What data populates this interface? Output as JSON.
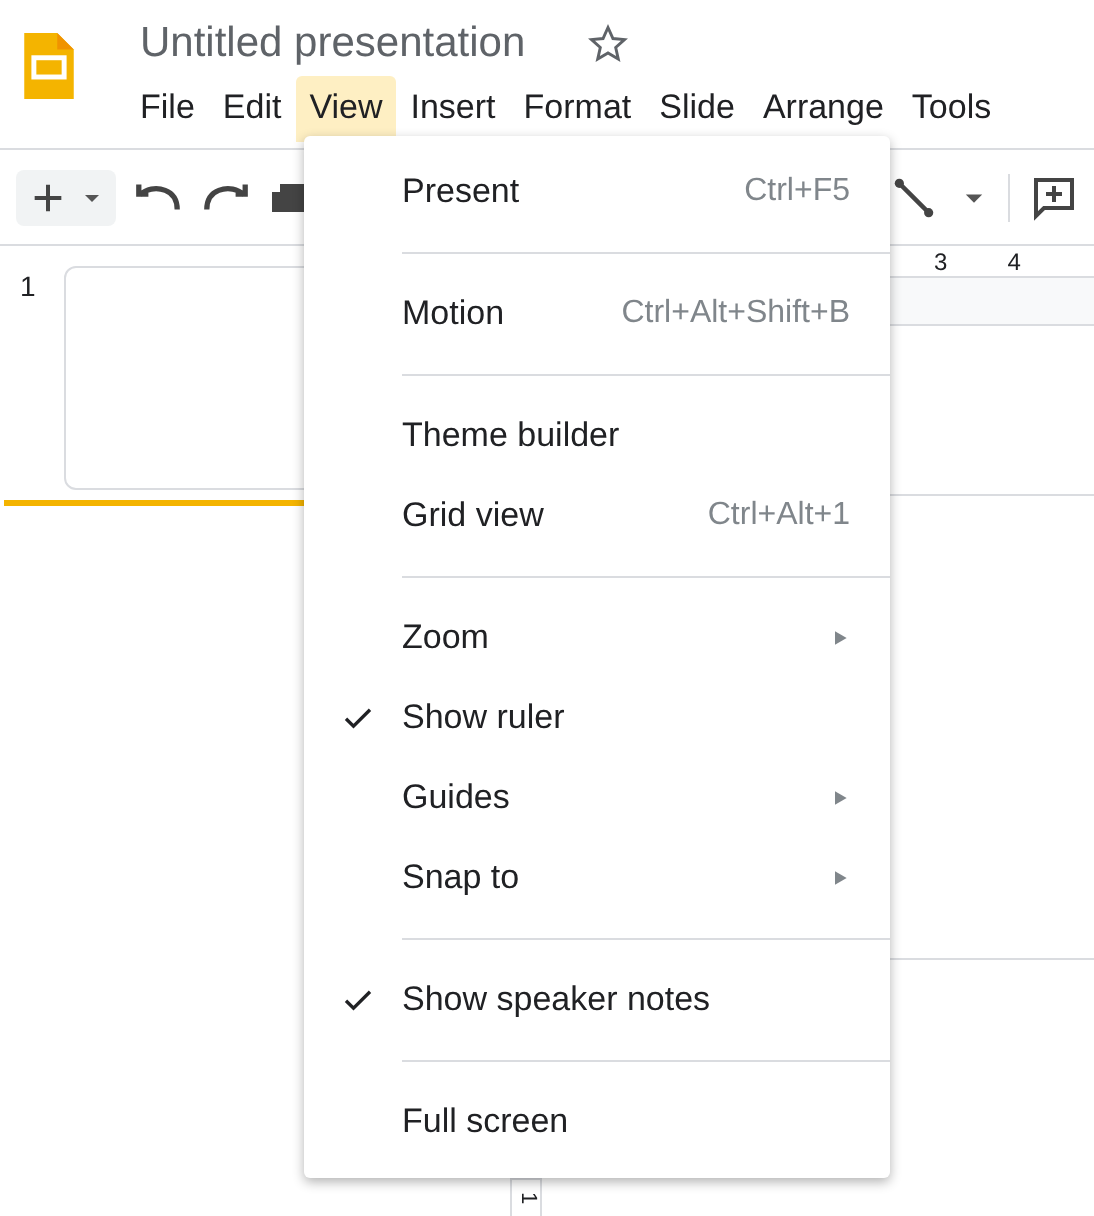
{
  "app": {
    "title": "Untitled presentation",
    "starred": false
  },
  "menu_bar": [
    {
      "label": "File",
      "selected": false
    },
    {
      "label": "Edit",
      "selected": false
    },
    {
      "label": "View",
      "selected": true
    },
    {
      "label": "Insert",
      "selected": false
    },
    {
      "label": "Format",
      "selected": false
    },
    {
      "label": "Slide",
      "selected": false
    },
    {
      "label": "Arrange",
      "selected": false
    },
    {
      "label": "Tools",
      "selected": false
    }
  ],
  "filmstrip": {
    "slide_number": "1"
  },
  "ruler": {
    "labels": [
      "3",
      "4"
    ]
  },
  "vertical_ruler": {
    "label": "1"
  },
  "view_menu": {
    "sections": [
      {
        "items": [
          {
            "label": "Present",
            "shortcut": "Ctrl+F5",
            "submenu": false,
            "checked": false
          }
        ]
      },
      {
        "items": [
          {
            "label": "Motion",
            "shortcut": "Ctrl+Alt+Shift+B",
            "submenu": false,
            "checked": false
          }
        ]
      },
      {
        "items": [
          {
            "label": "Theme builder",
            "submenu": false,
            "checked": false
          },
          {
            "label": "Grid view",
            "shortcut": "Ctrl+Alt+1",
            "submenu": false,
            "checked": false
          }
        ]
      },
      {
        "items": [
          {
            "label": "Zoom",
            "submenu": true,
            "checked": false
          },
          {
            "label": "Show ruler",
            "submenu": false,
            "checked": true
          },
          {
            "label": "Guides",
            "submenu": true,
            "checked": false
          },
          {
            "label": "Snap to",
            "submenu": true,
            "checked": false
          }
        ]
      },
      {
        "items": [
          {
            "label": "Show speaker notes",
            "submenu": false,
            "checked": true
          }
        ]
      },
      {
        "items": [
          {
            "label": "Full screen",
            "submenu": false,
            "checked": false
          }
        ]
      }
    ]
  }
}
